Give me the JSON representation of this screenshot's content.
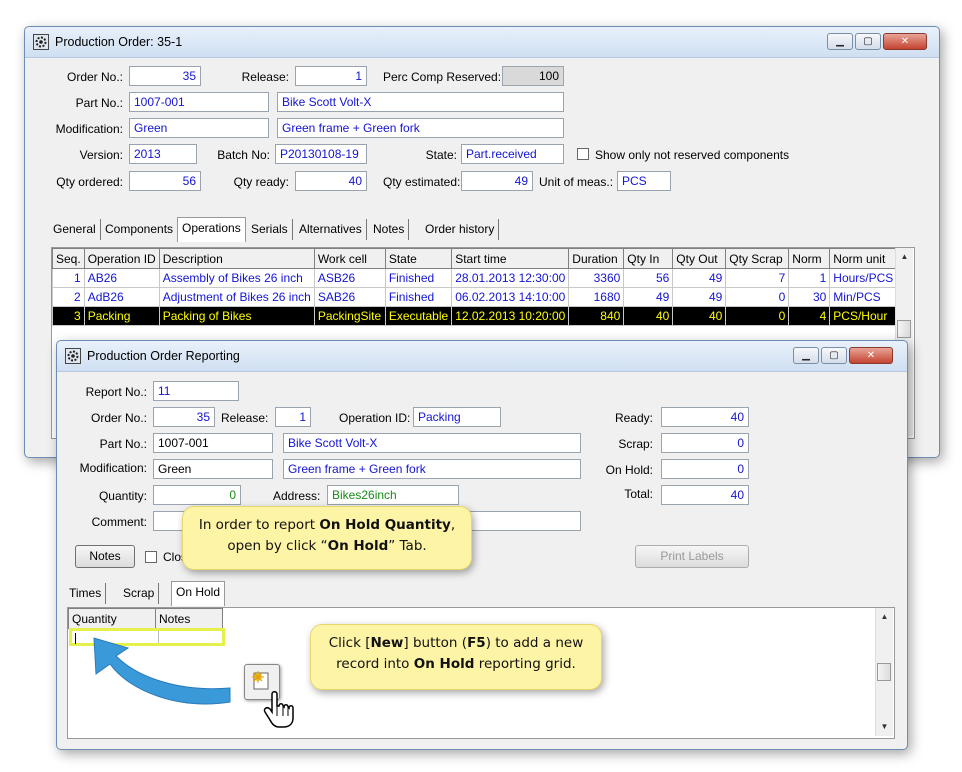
{
  "main": {
    "title": "Production Order: 35-1",
    "labels": {
      "order_no": "Order No.:",
      "release": "Release:",
      "perc": "Perc Comp Reserved:",
      "part_no": "Part No.:",
      "modification": "Modification:",
      "version": "Version:",
      "batch_no": "Batch No:",
      "state": "State:",
      "show_only": "Show only not reserved components",
      "qty_ordered": "Qty ordered:",
      "qty_ready": "Qty ready:",
      "qty_estimated": "Qty estimated:",
      "unit": "Unit of meas.:"
    },
    "values": {
      "order_no": "35",
      "release": "1",
      "perc": "100",
      "part_no": "1007-001",
      "part_desc": "Bike Scott Volt-X",
      "modification": "Green",
      "mod_desc": "Green frame + Green fork",
      "version": "2013",
      "batch_no": "P20130108-19",
      "state": "Part.received",
      "qty_ordered": "56",
      "qty_ready": "40",
      "qty_estimated": "49",
      "unit": "PCS"
    },
    "tabs": [
      "General",
      "Components",
      "Operations",
      "Serials",
      "Alternatives",
      "Notes",
      "Order history"
    ],
    "active_tab": "Operations",
    "grid": {
      "columns": [
        "Seq.",
        "Operation ID",
        "Description",
        "Work cell",
        "State",
        "Start time",
        "Duration",
        "Qty In",
        "Qty Out",
        "Qty Scrap",
        "Norm",
        "Norm unit"
      ],
      "rows": [
        [
          "1",
          "AB26",
          "Assembly of Bikes 26 inch",
          "ASB26",
          "Finished",
          "28.01.2013 12:30:00",
          "3360",
          "56",
          "49",
          "7",
          "1",
          "Hours/PCS"
        ],
        [
          "2",
          "AdB26",
          "Adjustment of Bikes 26 inch",
          "SAB26",
          "Finished",
          "06.02.2013 14:10:00",
          "1680",
          "49",
          "49",
          "0",
          "30",
          "Min/PCS"
        ],
        [
          "3",
          "Packing",
          "Packing of Bikes",
          "PackingSite",
          "Executable",
          "12.02.2013 10:20:00",
          "840",
          "40",
          "40",
          "0",
          "4",
          "PCS/Hour"
        ]
      ]
    }
  },
  "report": {
    "title": "Production Order Reporting",
    "labels": {
      "report_no": "Report No.:",
      "order_no": "Order No.:",
      "release": "Release:",
      "operation_id": "Operation ID:",
      "part_no": "Part No.:",
      "modification": "Modification:",
      "quantity": "Quantity:",
      "address": "Address:",
      "comment": "Comment:",
      "ready": "Ready:",
      "scrap": "Scrap:",
      "on_hold": "On Hold:",
      "total": "Total:"
    },
    "values": {
      "report_no": "11",
      "order_no": "35",
      "release": "1",
      "operation_id": "Packing",
      "part_no": "1007-001",
      "part_desc": "Bike Scott Volt-X",
      "modification": "Green",
      "mod_desc": "Green frame + Green fork",
      "quantity": "0",
      "address": "Bikes26inch",
      "comment": "",
      "ready": "40",
      "scrap": "0",
      "on_hold": "0",
      "total": "40"
    },
    "notes_button": "Notes",
    "close_label_partial": "Clos",
    "print_labels": "Print Labels",
    "tabs": [
      "Times",
      "Scrap",
      "On Hold"
    ],
    "active_tab": "On Hold",
    "hold_grid": {
      "columns": [
        "Quantity",
        "Notes"
      ]
    }
  },
  "callouts": {
    "c1_pre": "In order to report ",
    "c1_bold1": "On Hold Quantity",
    "c1_mid": ",",
    "c1_l2_pre": "open by click “",
    "c1_bold2": "On Hold",
    "c1_l2_post": "” Tab.",
    "c2_pre": "Click [",
    "c2_bold1": "New",
    "c2_mid1": "] button (",
    "c2_bold2": "F5",
    "c2_mid2": ") to add a new",
    "c2_l2_pre": "record into ",
    "c2_bold3": "On Hold",
    "c2_l2_post": " reporting grid."
  },
  "colors": {
    "field_text": "#1414d4",
    "highlight": "#e5f04a",
    "callout_bg": "#fdf4a6",
    "arrow": "#3a9ad9"
  }
}
